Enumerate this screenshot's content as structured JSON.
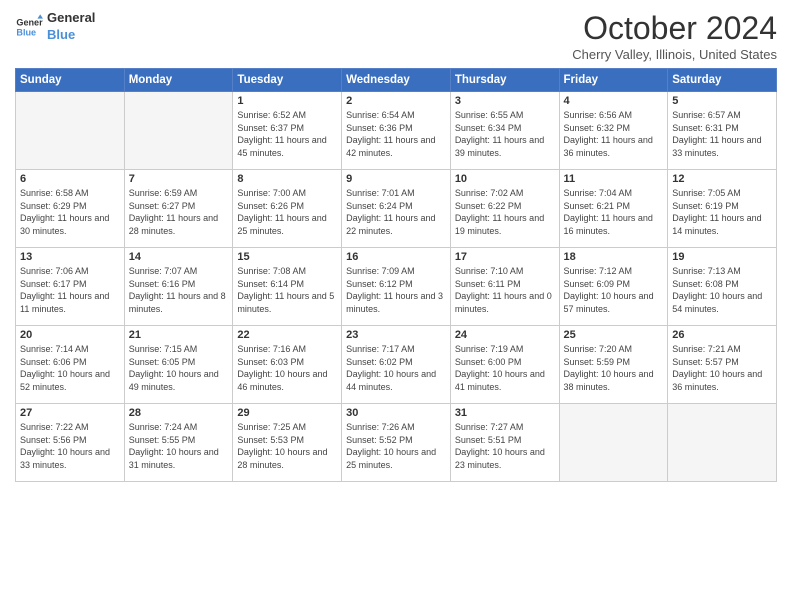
{
  "header": {
    "logo_line1": "General",
    "logo_line2": "Blue",
    "month": "October 2024",
    "location": "Cherry Valley, Illinois, United States"
  },
  "days_of_week": [
    "Sunday",
    "Monday",
    "Tuesday",
    "Wednesday",
    "Thursday",
    "Friday",
    "Saturday"
  ],
  "weeks": [
    [
      {
        "day": "",
        "info": ""
      },
      {
        "day": "",
        "info": ""
      },
      {
        "day": "1",
        "info": "Sunrise: 6:52 AM\nSunset: 6:37 PM\nDaylight: 11 hours and 45 minutes."
      },
      {
        "day": "2",
        "info": "Sunrise: 6:54 AM\nSunset: 6:36 PM\nDaylight: 11 hours and 42 minutes."
      },
      {
        "day": "3",
        "info": "Sunrise: 6:55 AM\nSunset: 6:34 PM\nDaylight: 11 hours and 39 minutes."
      },
      {
        "day": "4",
        "info": "Sunrise: 6:56 AM\nSunset: 6:32 PM\nDaylight: 11 hours and 36 minutes."
      },
      {
        "day": "5",
        "info": "Sunrise: 6:57 AM\nSunset: 6:31 PM\nDaylight: 11 hours and 33 minutes."
      }
    ],
    [
      {
        "day": "6",
        "info": "Sunrise: 6:58 AM\nSunset: 6:29 PM\nDaylight: 11 hours and 30 minutes."
      },
      {
        "day": "7",
        "info": "Sunrise: 6:59 AM\nSunset: 6:27 PM\nDaylight: 11 hours and 28 minutes."
      },
      {
        "day": "8",
        "info": "Sunrise: 7:00 AM\nSunset: 6:26 PM\nDaylight: 11 hours and 25 minutes."
      },
      {
        "day": "9",
        "info": "Sunrise: 7:01 AM\nSunset: 6:24 PM\nDaylight: 11 hours and 22 minutes."
      },
      {
        "day": "10",
        "info": "Sunrise: 7:02 AM\nSunset: 6:22 PM\nDaylight: 11 hours and 19 minutes."
      },
      {
        "day": "11",
        "info": "Sunrise: 7:04 AM\nSunset: 6:21 PM\nDaylight: 11 hours and 16 minutes."
      },
      {
        "day": "12",
        "info": "Sunrise: 7:05 AM\nSunset: 6:19 PM\nDaylight: 11 hours and 14 minutes."
      }
    ],
    [
      {
        "day": "13",
        "info": "Sunrise: 7:06 AM\nSunset: 6:17 PM\nDaylight: 11 hours and 11 minutes."
      },
      {
        "day": "14",
        "info": "Sunrise: 7:07 AM\nSunset: 6:16 PM\nDaylight: 11 hours and 8 minutes."
      },
      {
        "day": "15",
        "info": "Sunrise: 7:08 AM\nSunset: 6:14 PM\nDaylight: 11 hours and 5 minutes."
      },
      {
        "day": "16",
        "info": "Sunrise: 7:09 AM\nSunset: 6:12 PM\nDaylight: 11 hours and 3 minutes."
      },
      {
        "day": "17",
        "info": "Sunrise: 7:10 AM\nSunset: 6:11 PM\nDaylight: 11 hours and 0 minutes."
      },
      {
        "day": "18",
        "info": "Sunrise: 7:12 AM\nSunset: 6:09 PM\nDaylight: 10 hours and 57 minutes."
      },
      {
        "day": "19",
        "info": "Sunrise: 7:13 AM\nSunset: 6:08 PM\nDaylight: 10 hours and 54 minutes."
      }
    ],
    [
      {
        "day": "20",
        "info": "Sunrise: 7:14 AM\nSunset: 6:06 PM\nDaylight: 10 hours and 52 minutes."
      },
      {
        "day": "21",
        "info": "Sunrise: 7:15 AM\nSunset: 6:05 PM\nDaylight: 10 hours and 49 minutes."
      },
      {
        "day": "22",
        "info": "Sunrise: 7:16 AM\nSunset: 6:03 PM\nDaylight: 10 hours and 46 minutes."
      },
      {
        "day": "23",
        "info": "Sunrise: 7:17 AM\nSunset: 6:02 PM\nDaylight: 10 hours and 44 minutes."
      },
      {
        "day": "24",
        "info": "Sunrise: 7:19 AM\nSunset: 6:00 PM\nDaylight: 10 hours and 41 minutes."
      },
      {
        "day": "25",
        "info": "Sunrise: 7:20 AM\nSunset: 5:59 PM\nDaylight: 10 hours and 38 minutes."
      },
      {
        "day": "26",
        "info": "Sunrise: 7:21 AM\nSunset: 5:57 PM\nDaylight: 10 hours and 36 minutes."
      }
    ],
    [
      {
        "day": "27",
        "info": "Sunrise: 7:22 AM\nSunset: 5:56 PM\nDaylight: 10 hours and 33 minutes."
      },
      {
        "day": "28",
        "info": "Sunrise: 7:24 AM\nSunset: 5:55 PM\nDaylight: 10 hours and 31 minutes."
      },
      {
        "day": "29",
        "info": "Sunrise: 7:25 AM\nSunset: 5:53 PM\nDaylight: 10 hours and 28 minutes."
      },
      {
        "day": "30",
        "info": "Sunrise: 7:26 AM\nSunset: 5:52 PM\nDaylight: 10 hours and 25 minutes."
      },
      {
        "day": "31",
        "info": "Sunrise: 7:27 AM\nSunset: 5:51 PM\nDaylight: 10 hours and 23 minutes."
      },
      {
        "day": "",
        "info": ""
      },
      {
        "day": "",
        "info": ""
      }
    ]
  ]
}
